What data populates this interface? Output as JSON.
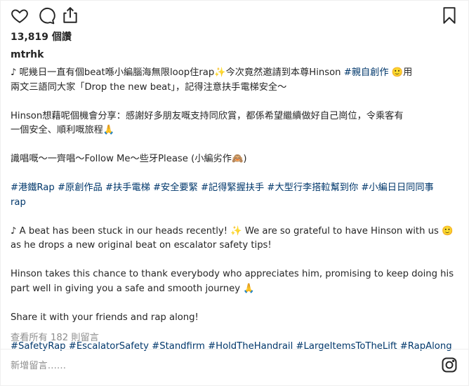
{
  "post": {
    "likes": "13,819 個讚",
    "username": "mtrhk",
    "caption_lines": [
      "♪ 呢幾日一直有個beat喺小編腦海無限loop住rap✨今次竟然邀請到本尊Hinson",
      "兩文三語同大家「Drop the new beat」，記得注意扶手電梯安全～",
      "",
      "Hinson想藉呢個機會分享：感謝好多朋友嘅支持同欣賞，都係希望繼續做好自己崗位，令乘客有",
      "一個安全、順利嘅旅程🙏",
      "",
      "識唱嘅～一齊唱～Follow Me～些牙Please (小編劣作🙈)",
      "",
      "",
      "rap",
      "",
      "♪ A beat has been stuck in our heads recently! ✨ We are so grateful to have Hinson with us 🙂",
      "as he drops a new original beat on escalator safety tips!",
      "",
      "Hinson takes this chance to thank everybody who appreciates him, promising to keep doing his",
      "part well in giving you a safe and smooth journey 🙏",
      "",
      "Share it with your friends and rap along!",
      "",
      ""
    ],
    "line1_tag": "#親自創作",
    "line1_tail": " 🙂用",
    "zh_hashtags": [
      "#港鐵Rap",
      "#原創作品",
      "#扶手電梯",
      "#安全要緊",
      "#記得緊握扶手",
      "#大型行李搭𨋢幫到你",
      "#小編日日同同事"
    ],
    "en_hashtags": [
      "#SafetyRap",
      "#EscalatorSafety",
      "#Standfirm",
      "#HoldTheHandrail",
      "#LargeItemsToTheLift",
      "#RapAlong"
    ],
    "view_all_comments": "查看所有 182 則留言"
  },
  "comment": {
    "placeholder": "新增留言……"
  },
  "icons": {
    "like": "heart-icon",
    "comment": "comment-bubble-icon",
    "share": "share-icon",
    "save": "bookmark-icon",
    "brand": "instagram-icon"
  },
  "colors": {
    "text": "#262626",
    "hashtag": "#00376b",
    "muted": "#8e8e8e"
  }
}
